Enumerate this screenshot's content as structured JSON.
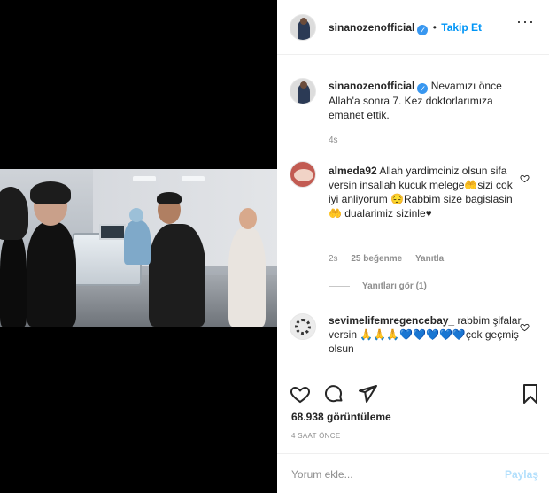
{
  "post": {
    "author": "sinanozenofficial",
    "follow_label": "Takip Et",
    "caption": "Nevamızı önce Allah'a sonra 7. Kez doktorlarımıza emanet ettik.",
    "caption_time": "4s"
  },
  "comments": [
    {
      "username": "almeda92",
      "text": "Allah yardimciniz olsun sifa versin insallah kucuk melege🤲sizi cok iyi anliyorum 😔Rabbim size bagislasin🤲 dualarimiz sizinle♥",
      "time": "2s",
      "likes": "25 beğenme",
      "reply_label": "Yanıtla",
      "view_replies": "Yanıtları gör (1)"
    },
    {
      "username": "sevimelifemregencebay_",
      "text": "rabbim şifalar versin 🙏🙏🙏💙💙💙💙💙çok geçmiş olsun"
    }
  ],
  "stats": {
    "views": "68.938 görüntüleme",
    "timestamp": "4 SAAT ÖNCE"
  },
  "comment_box": {
    "placeholder": "Yorum ekle...",
    "post_label": "Paylaş"
  },
  "colors": {
    "accent": "#0095f6",
    "verified": "#3897f0",
    "muted": "#8e8e8e"
  },
  "icons": [
    "more-options-icon",
    "verified-badge-icon",
    "heart-icon",
    "comment-icon",
    "share-icon",
    "bookmark-icon"
  ]
}
